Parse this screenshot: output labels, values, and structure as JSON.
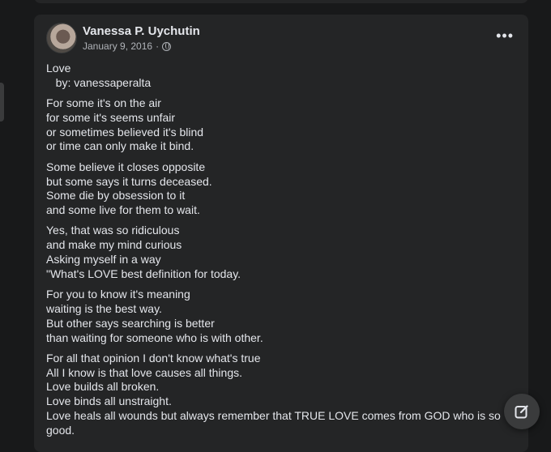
{
  "post": {
    "author": "Vanessa P. Uychutin",
    "date": "January 9, 2016",
    "separator": "·",
    "privacy_icon": "globe-icon",
    "more_label": "•••",
    "stanzas": [
      [
        "Love",
        "   by: vanessaperalta"
      ],
      [
        "For some it's on the air",
        "for some it's seems unfair",
        "or sometimes believed it's blind",
        "or time can only make it bind."
      ],
      [
        "Some believe it closes opposite",
        "but some says it turns deceased.",
        "Some die by obsession to it",
        "and some live for them to wait."
      ],
      [
        "Yes, that was so ridiculous",
        "and make my mind curious",
        "Asking myself in a way",
        "\"What's LOVE best definition for today."
      ],
      [
        "For you to know it's meaning",
        "waiting is the best way.",
        "But other says searching is better",
        "than waiting for someone who is with other."
      ],
      [
        "For all that opinion I don't know what's true",
        "All I know is that love causes all things.",
        "Love builds all broken.",
        "Love binds all unstraight.",
        "Love heals all wounds but always remember that TRUE LOVE comes from GOD who is so good."
      ]
    ]
  },
  "compose_icon": "compose-icon"
}
